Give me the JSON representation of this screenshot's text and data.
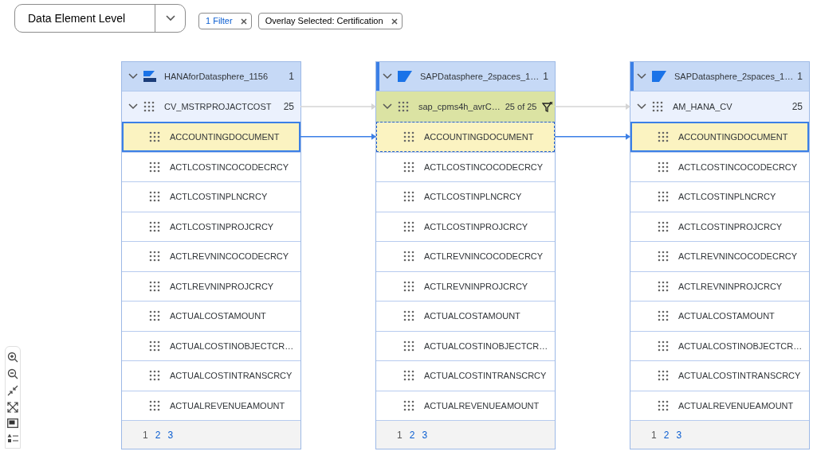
{
  "view_select": {
    "value": "Data Element Level"
  },
  "filters": [
    {
      "label": "1 Filter",
      "kind": "link"
    },
    {
      "label": "Overlay Selected: Certification",
      "kind": "plain"
    }
  ],
  "nodes": [
    {
      "source": {
        "name": "HANAforDatasphere_1156",
        "count": "1",
        "kind": "hana",
        "accent": false
      },
      "dataset": {
        "name": "CV_MSTRPROJACTCOST",
        "count": "25",
        "expanded": true,
        "filtered": false
      },
      "focused": false,
      "fields": [
        {
          "name": "ACCOUNTINGDOCUMENT",
          "selected": true
        },
        {
          "name": "ACTLCOSTINCOCODECRCY",
          "selected": false
        },
        {
          "name": "ACTLCOSTINPLNCRCY",
          "selected": false
        },
        {
          "name": "ACTLCOSTINPROJCRCY",
          "selected": false
        },
        {
          "name": "ACTLREVNINCOCODECRCY",
          "selected": false
        },
        {
          "name": "ACTLREVNINPROJCRCY",
          "selected": false
        },
        {
          "name": "ACTUALCOSTAMOUNT",
          "selected": false
        },
        {
          "name": "ACTUALCOSTINOBJECTCR…",
          "selected": false
        },
        {
          "name": "ACTUALCOSTINTRANSCRCY",
          "selected": false
        },
        {
          "name": "ACTUALREVENUEAMOUNT",
          "selected": false
        }
      ],
      "pages": [
        {
          "label": "1",
          "selected": true
        },
        {
          "label": "2",
          "selected": false
        },
        {
          "label": "3",
          "selected": false
        }
      ]
    },
    {
      "source": {
        "name": "SAPDatasphere_2spaces_1…",
        "count": "1",
        "kind": "sap",
        "accent": true
      },
      "dataset": {
        "name": "sap_cpms4h_avrC…",
        "count": "25 of 25",
        "expanded": true,
        "filtered": true
      },
      "focused": true,
      "fields": [
        {
          "name": "ACCOUNTINGDOCUMENT",
          "selected": true
        },
        {
          "name": "ACTLCOSTINCOCODECRCY",
          "selected": false
        },
        {
          "name": "ACTLCOSTINPLNCRCY",
          "selected": false
        },
        {
          "name": "ACTLCOSTINPROJCRCY",
          "selected": false
        },
        {
          "name": "ACTLREVNINCOCODECRCY",
          "selected": false
        },
        {
          "name": "ACTLREVNINPROJCRCY",
          "selected": false
        },
        {
          "name": "ACTUALCOSTAMOUNT",
          "selected": false
        },
        {
          "name": "ACTUALCOSTINOBJECTCR…",
          "selected": false
        },
        {
          "name": "ACTUALCOSTINTRANSCRCY",
          "selected": false
        },
        {
          "name": "ACTUALREVENUEAMOUNT",
          "selected": false
        }
      ],
      "pages": [
        {
          "label": "1",
          "selected": true
        },
        {
          "label": "2",
          "selected": false
        },
        {
          "label": "3",
          "selected": false
        }
      ]
    },
    {
      "source": {
        "name": "SAPDatasphere_2spaces_1…",
        "count": "1",
        "kind": "sap",
        "accent": true
      },
      "dataset": {
        "name": "AM_HANA_CV",
        "count": "25",
        "expanded": true,
        "filtered": false
      },
      "focused": false,
      "fields": [
        {
          "name": "ACCOUNTINGDOCUMENT",
          "selected": true
        },
        {
          "name": "ACTLCOSTINCOCODECRCY",
          "selected": false
        },
        {
          "name": "ACTLCOSTINPLNCRCY",
          "selected": false
        },
        {
          "name": "ACTLCOSTINPROJCRCY",
          "selected": false
        },
        {
          "name": "ACTLREVNINCOCODECRCY",
          "selected": false
        },
        {
          "name": "ACTLREVNINPROJCRCY",
          "selected": false
        },
        {
          "name": "ACTUALCOSTAMOUNT",
          "selected": false
        },
        {
          "name": "ACTUALCOSTINOBJECTCR…",
          "selected": false
        },
        {
          "name": "ACTUALCOSTINTRANSCRCY",
          "selected": false
        },
        {
          "name": "ACTUALREVENUEAMOUNT",
          "selected": false
        }
      ],
      "pages": [
        {
          "label": "1",
          "selected": true
        },
        {
          "label": "2",
          "selected": false
        },
        {
          "label": "3",
          "selected": false
        }
      ]
    }
  ]
}
